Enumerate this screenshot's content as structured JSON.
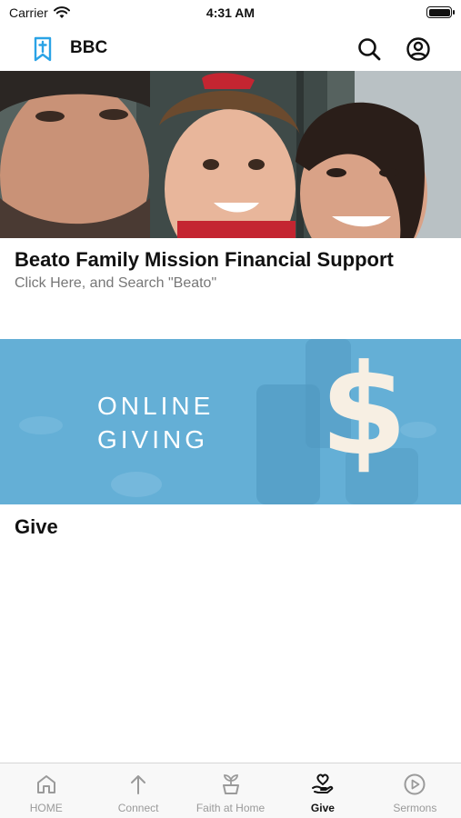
{
  "status_bar": {
    "carrier": "Carrier",
    "time": "4:31 AM"
  },
  "header": {
    "title": "BBC",
    "logo_icon": "bookmark-cross-icon"
  },
  "cards": [
    {
      "title": "Beato Family Mission Financial Support",
      "subtitle": "Click Here, and Search \"Beato\""
    },
    {
      "banner_line1": "ONLINE",
      "banner_line2": "GIVING",
      "banner_symbol": "$",
      "title": "Give"
    }
  ],
  "tabs": [
    {
      "label": "HOME",
      "icon": "home-icon",
      "active": false
    },
    {
      "label": "Connect",
      "icon": "arrow-up-icon",
      "active": false
    },
    {
      "label": "Faith at Home",
      "icon": "plant-pot-icon",
      "active": false
    },
    {
      "label": "Give",
      "icon": "heart-hand-icon",
      "active": true
    },
    {
      "label": "Sermons",
      "icon": "play-circle-icon",
      "active": false
    }
  ],
  "colors": {
    "accent": "#2aa3e6",
    "giving_bg": "#64afd6",
    "tab_inactive": "#9a9a9a"
  }
}
